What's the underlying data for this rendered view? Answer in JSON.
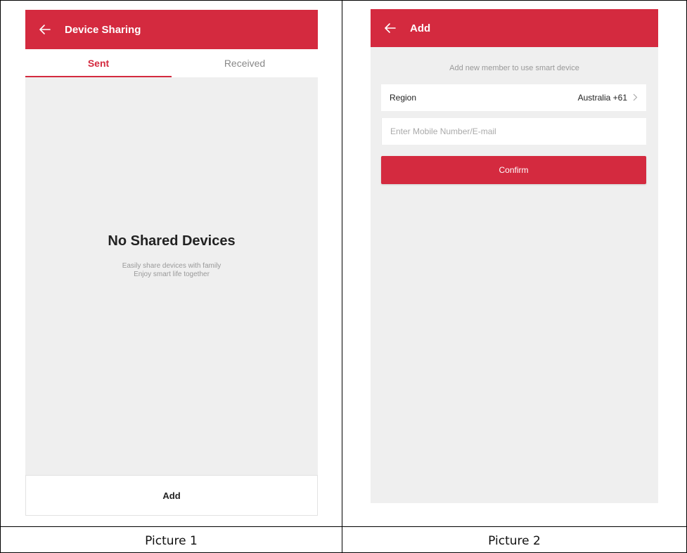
{
  "picture1": {
    "caption": "Picture 1",
    "header": {
      "title": "Device Sharing"
    },
    "tabs": [
      {
        "label": "Sent",
        "active": true
      },
      {
        "label": "Received",
        "active": false
      }
    ],
    "empty_state": {
      "title": "No Shared Devices",
      "line1": "Easily share devices with family",
      "line2": "Enjoy smart life together"
    },
    "add_label": "Add"
  },
  "picture2": {
    "caption": "Picture 2",
    "header": {
      "title": "Add"
    },
    "hint": "Add new member to use smart device",
    "region": {
      "label": "Region",
      "value": "Australia +61"
    },
    "contact_input": {
      "placeholder": "Enter Mobile Number/E-mail",
      "value": ""
    },
    "confirm_label": "Confirm"
  },
  "colors": {
    "accent": "#d42a3f",
    "background": "#efefef",
    "muted_text": "#999999"
  },
  "icons": {
    "back": "arrow-left-icon",
    "chevron": "chevron-right-icon"
  }
}
